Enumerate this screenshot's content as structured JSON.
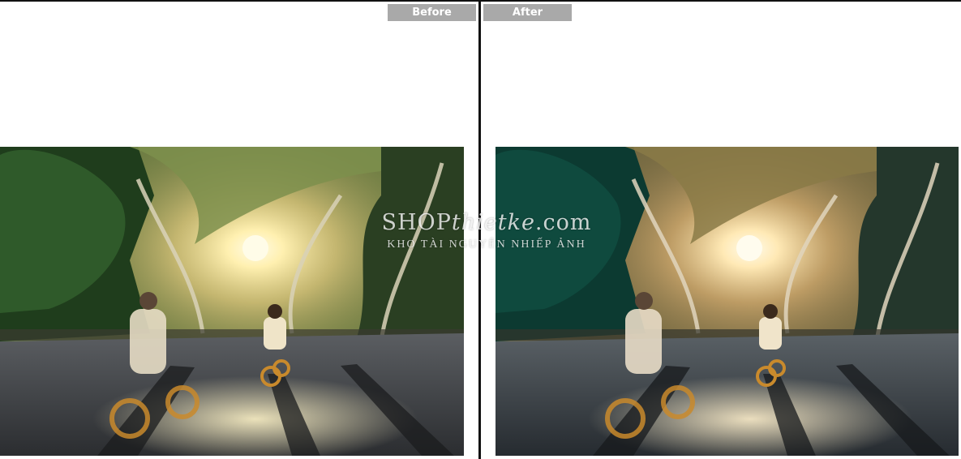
{
  "labels": {
    "before": "Before",
    "after": "After"
  },
  "watermark": {
    "title_left": "SHOP",
    "title_script": "thietke",
    "title_right": ".com",
    "subtitle": "KHO TÀI NGUYÊN NHIẾP ẢNH"
  },
  "colors": {
    "label_background": "#a9a9a9",
    "divider": "#111111",
    "before_foliage": "#2f5a2a",
    "after_foliage": "#0f4a3e",
    "sun": "#fff6cf"
  },
  "images": {
    "before": {
      "icon": "photo-street-cyclists-before"
    },
    "after": {
      "icon": "photo-street-cyclists-after"
    }
  }
}
